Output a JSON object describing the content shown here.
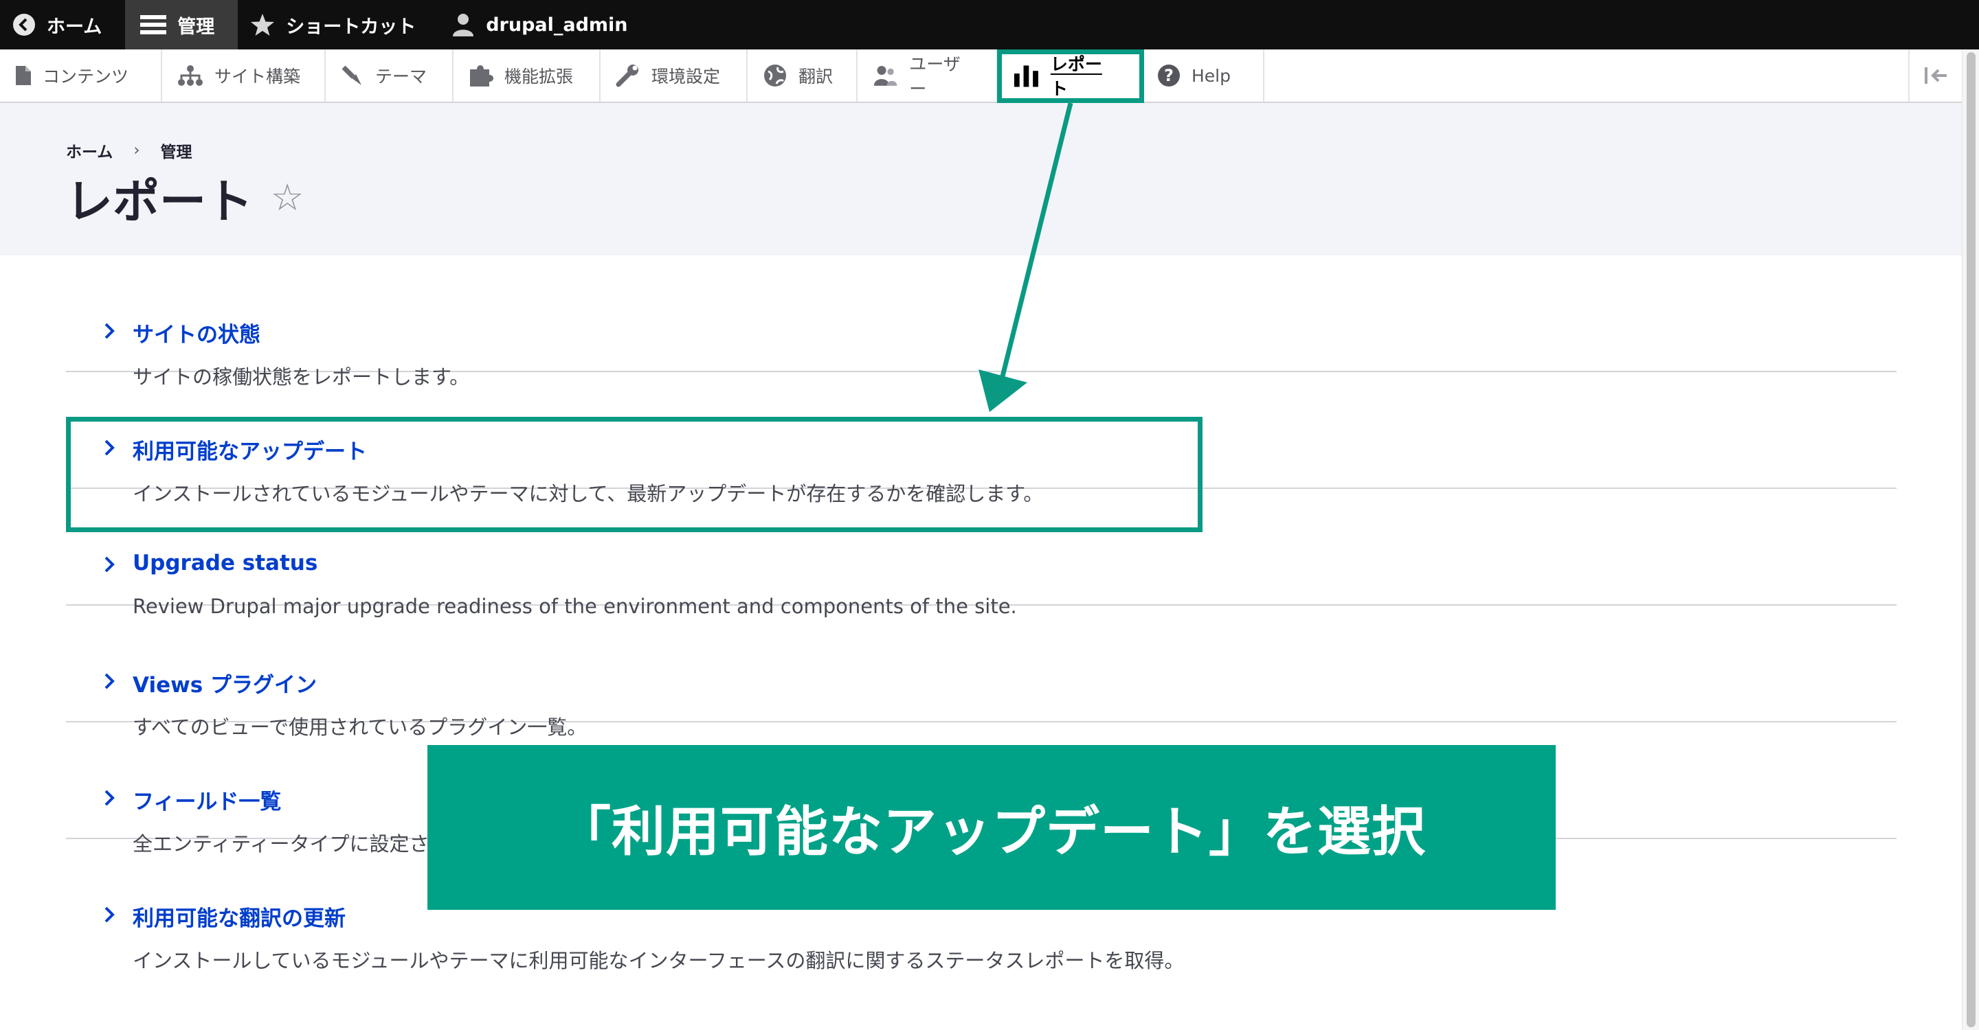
{
  "toolbar": {
    "items": [
      {
        "label": "ホーム",
        "icon": "back-circle-icon"
      },
      {
        "label": "管理",
        "icon": "menu-icon"
      },
      {
        "label": "ショートカット",
        "icon": "star-icon"
      },
      {
        "label": "drupal_admin",
        "icon": "user-icon"
      }
    ]
  },
  "tray": {
    "items": [
      {
        "label": "コンテンツ",
        "icon": "document-icon"
      },
      {
        "label": "サイト構築",
        "icon": "sitemap-icon"
      },
      {
        "label": "テーマ",
        "icon": "paintbrush-icon"
      },
      {
        "label": "機能拡張",
        "icon": "puzzle-icon"
      },
      {
        "label": "環境設定",
        "icon": "wrench-icon"
      },
      {
        "label": "翻訳",
        "icon": "globe-icon"
      },
      {
        "label": "ユーザー",
        "icon": "people-icon"
      },
      {
        "label": "レポート",
        "icon": "bar-chart-icon"
      },
      {
        "label": "Help",
        "icon": "help-icon"
      }
    ],
    "collapse_icon": "collapse-icon"
  },
  "breadcrumb": {
    "home": "ホーム",
    "separator": "›",
    "current": "管理"
  },
  "page": {
    "title": "レポート",
    "favorite_icon": "☆"
  },
  "reports": [
    {
      "title": "サイトの状態",
      "description": "サイトの稼働状態をレポートします。"
    },
    {
      "title": "利用可能なアップデート",
      "description": "インストールされているモジュールやテーマに対して、最新アップデートが存在するかを確認します。"
    },
    {
      "title": "Upgrade status",
      "description": "Review Drupal major upgrade readiness of the environment and components of the site."
    },
    {
      "title": "Views プラグイン",
      "description": "すべてのビューで使用されているプラグイン一覧。"
    },
    {
      "title": "フィールド一覧",
      "description": "全エンティティータイプに設定されているフィールド一覧。"
    },
    {
      "title": "利用可能な翻訳の更新",
      "description": "インストールしているモジュールやテーマに利用可能なインターフェースの翻訳に関するステータスレポートを取得。"
    }
  ],
  "callout": {
    "text": "「利用可能なアップデート」を選択"
  },
  "colors": {
    "accent": "#00a287",
    "link": "#003ecc",
    "toolbar": "#0f0f0f"
  }
}
